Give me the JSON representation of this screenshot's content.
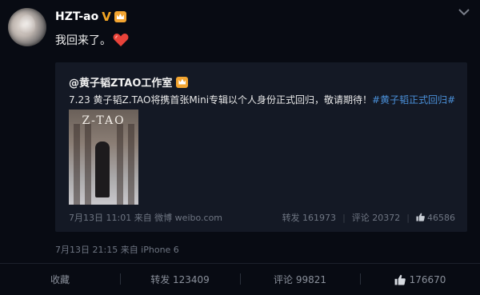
{
  "post": {
    "username": "HZT-ao",
    "verified_mark": "V",
    "text": "我回来了。",
    "time": "7月13日 21:15 来自 iPhone 6"
  },
  "repost": {
    "author": "@黄子韬ZTAO工作室",
    "text_main": "7.23 黄子韬Z.TAO将携首张Mini专辑以个人身份正式回归，敬请期待！",
    "hashtag": "#黄子韬正式回归#",
    "poster_title": "Z-TAO",
    "time": "7月13日 11:01 来自 微博 weibo.com",
    "repost_label": "转发 161973",
    "comment_label": "评论 20372",
    "like_count": "46586"
  },
  "actions": {
    "favorite": "收藏",
    "repost": "转发 123409",
    "comment": "评论 99821",
    "like": "176670"
  },
  "colors": {
    "background": "#080b13",
    "repost_background": "#141925",
    "link": "#4a90d9",
    "badge": "#f3a531",
    "heart": "#e8433a"
  },
  "icons": [
    "chevron-down-icon",
    "verified-icon",
    "crown-badge-icon",
    "heart-emoji-icon",
    "thumbs-up-icon"
  ]
}
